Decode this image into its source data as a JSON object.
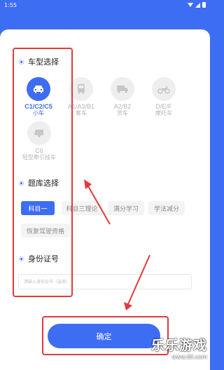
{
  "status_bar": {
    "time": "1:55"
  },
  "car_type": {
    "title": "车型选择",
    "items": [
      {
        "code": "C1/C2/C5",
        "name": "小车",
        "icon": "car-icon",
        "active": true
      },
      {
        "code": "A1/A3/B1",
        "name": "客车",
        "icon": "bus-icon",
        "active": false
      },
      {
        "code": "A2/B2",
        "name": "货车",
        "icon": "truck-icon",
        "active": false
      },
      {
        "code": "D/E/F",
        "name": "摩托车",
        "icon": "motorcycle-icon",
        "active": false
      },
      {
        "code": "C6",
        "name": "轻型牵引挂车",
        "icon": "trailer-icon",
        "active": false
      }
    ]
  },
  "question_bank": {
    "title": "题库选择",
    "items": [
      {
        "label": "科目一",
        "active": true
      },
      {
        "label": "科目三理论",
        "active": false
      },
      {
        "label": "满分学习",
        "active": false
      },
      {
        "label": "学法减分",
        "active": false
      },
      {
        "label": "恢复驾驶资格",
        "active": false
      }
    ]
  },
  "id_number": {
    "title": "身份证号",
    "placeholder": "请输入身份证号（选填）",
    "value": ""
  },
  "confirm_label": "确定",
  "watermark": {
    "title": "乐乐游戏",
    "url": "www.6ll.com"
  },
  "colors": {
    "accent": "#3d6df2",
    "annotation": "#e23a3a"
  }
}
